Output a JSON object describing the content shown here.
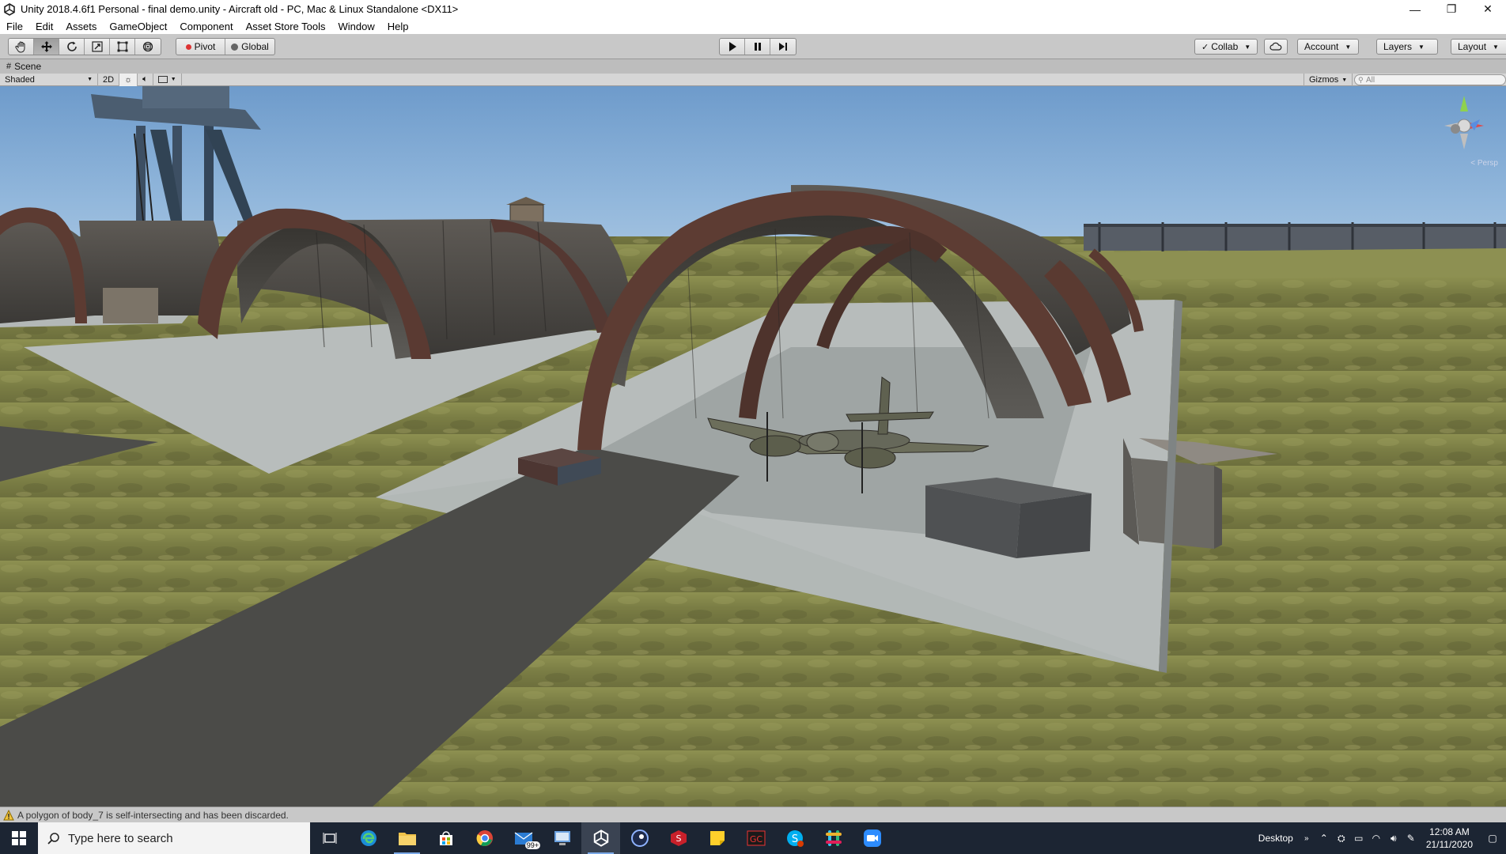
{
  "window": {
    "title": "Unity 2018.4.6f1 Personal - final demo.unity - Aircraft old - PC, Mac & Linux Standalone <DX11>",
    "controls": [
      "—",
      "❐",
      "✕"
    ]
  },
  "menu": [
    "File",
    "Edit",
    "Assets",
    "GameObject",
    "Component",
    "Asset Store Tools",
    "Window",
    "Help"
  ],
  "toolbar": {
    "tools": [
      "hand-tool",
      "move-tool",
      "rotate-tool",
      "scale-tool",
      "rect-tool",
      "transform-tool"
    ],
    "pivot_label": "Pivot",
    "global_label": "Global",
    "collab_label": "Collab",
    "account_label": "Account",
    "layers_label": "Layers",
    "layout_label": "Layout"
  },
  "scene": {
    "tab_label": "Scene",
    "shading_mode": "Shaded",
    "mode_2d": "2D",
    "gizmos_label": "Gizmos",
    "search_placeholder": "All",
    "persp_label": "< Persp"
  },
  "status": {
    "message": "A polygon of body_7 is self-intersecting and has been discarded."
  },
  "taskbar": {
    "search_placeholder": "Type here to search",
    "mail_badge": "99+",
    "desktop_label": "Desktop",
    "time": "12:08 AM",
    "date": "21/11/2020"
  },
  "colors": {
    "sky_top": "#6f9ccc",
    "sky_horizon": "#a9c6e1",
    "grass": "#7a7d44",
    "concrete": "#b7bcbb",
    "hangar_metal": "#4e4a45",
    "hangar_rib": "#5c3b32",
    "taskbar": "#1c2533",
    "toolbar": "#c8c8c8"
  }
}
